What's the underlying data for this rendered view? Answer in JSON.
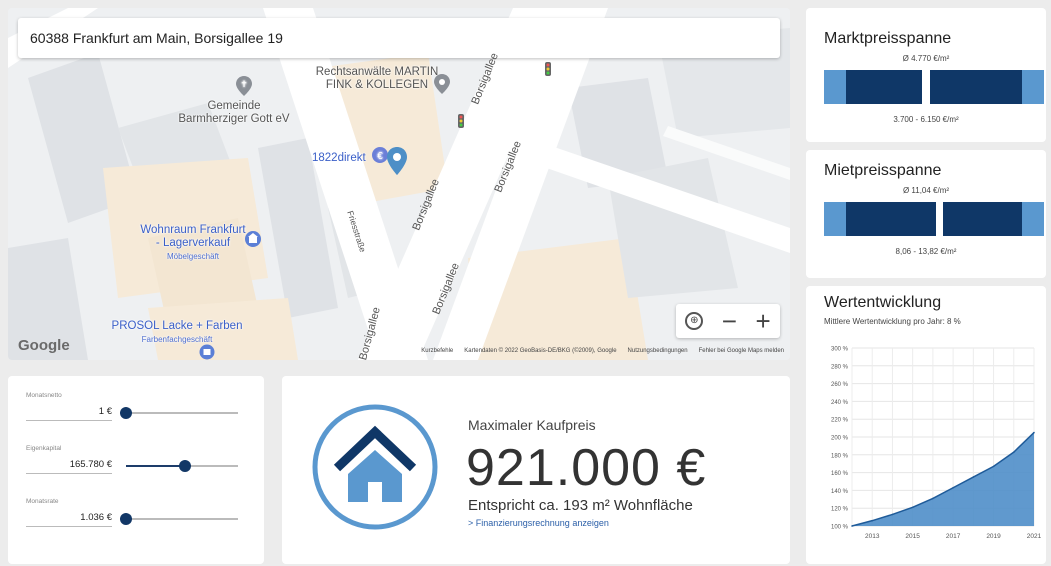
{
  "map": {
    "address": "60388 Frankfurt am Main, Borsigallee 19",
    "pois": {
      "church": [
        "Gemeinde",
        "Barmherziger Gott eV"
      ],
      "lawyer": [
        "Rechtsanwälte MARTIN",
        "FINK & KOLLEGEN"
      ],
      "bank": "1822direkt",
      "wohnraum": [
        "Wohnraum Frankfurt",
        "- Lagerverkauf"
      ],
      "wohnraum_sub": "Möbelgeschäft",
      "prosol": "PROSOL Lacke + Farben",
      "prosol_sub": "Farbenfachgeschäft"
    },
    "streets": {
      "borsigallee": "Borsigallee",
      "friesstrasse": "Friesstraße"
    },
    "google_logo": "Google",
    "attribution": {
      "shortcuts": "Kurzbefehle",
      "data": "Kartendaten © 2022 GeoBasis-DE/BKG (©2009), Google",
      "terms": "Nutzungsbedingungen",
      "report": "Fehler bei Google Maps melden"
    },
    "controls": {
      "zoom_out": "−",
      "zoom_in": "+",
      "compass": "⊕"
    }
  },
  "marktpreis": {
    "title": "Marktpreisspanne",
    "average": "Ø 4.770 €/m²",
    "range": "3.700 - 6.150 €/m²"
  },
  "mietpreis": {
    "title": "Mietpreisspanne",
    "average": "Ø 11,04 €/m²",
    "range": "8,06 - 13,82 €/m²"
  },
  "wertentwicklung": {
    "title": "Wertentwicklung",
    "subtitle": "Mittlere Wertentwicklung pro Jahr: 8 %"
  },
  "chart_data": {
    "type": "area",
    "x": [
      2012,
      2013,
      2014,
      2015,
      2016,
      2017,
      2018,
      2019,
      2020,
      2021
    ],
    "values": [
      100,
      106,
      113,
      121,
      131,
      143,
      155,
      167,
      183,
      205
    ],
    "xticks": [
      "2013",
      "2015",
      "2017",
      "2019",
      "2021"
    ],
    "yticks": [
      "100 %",
      "120 %",
      "140 %",
      "160 %",
      "180 %",
      "200 %",
      "220 %",
      "240 %",
      "260 %",
      "280 %",
      "300 %"
    ],
    "ylim": [
      100,
      300
    ],
    "grid": true,
    "color": "#4f8ec9"
  },
  "sliders": [
    {
      "label": "Monatsnetto",
      "value": "1 €",
      "fraction": 0.0
    },
    {
      "label": "Eigenkapital",
      "value": "165.780 €",
      "fraction": 0.53
    },
    {
      "label": "Monatsrate",
      "value": "1.036 €",
      "fraction": 0.0
    }
  ],
  "result": {
    "label": "Maximaler Kaufpreis",
    "value": "921.000 €",
    "subtext": "Entspricht ca. 193 m² Wohnfläche",
    "link": "> Finanzierungsrechnung anzeigen"
  },
  "colors": {
    "dark_blue": "#0f3767",
    "light_blue": "#5a98cf",
    "accent": "#4f8ec9"
  }
}
